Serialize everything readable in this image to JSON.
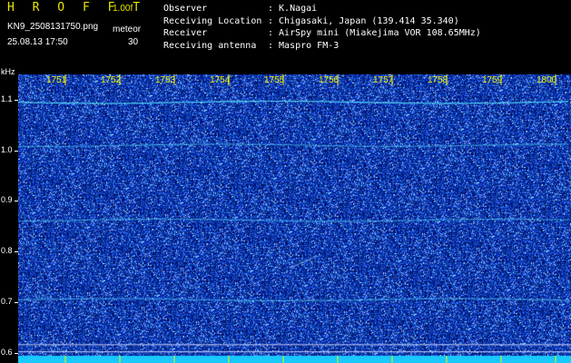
{
  "header": {
    "app_title": "H R O F F T",
    "version": "1.00f",
    "filename": "KN9_2508131750.png",
    "meteor_label": "meteor",
    "datetime": "25.08.13 17:50",
    "meteor_count": "30"
  },
  "info": [
    {
      "key": "Observer",
      "value": ": K.Nagai"
    },
    {
      "key": "Receiving Location",
      "value": ": Chigasaki, Japan (139.414 35.340)"
    },
    {
      "key": "Receiver",
      "value": ": AirSpy mini (Miakejima VOR 108.65MHz)"
    },
    {
      "key": "Receiving antenna",
      "value": ": Maspro FM-3"
    }
  ],
  "plot": {
    "unit_label": "kHz",
    "y_ticks": [
      "1.1",
      "1.0",
      "0.9",
      "0.8",
      "0.7",
      "0.6"
    ],
    "y_range": [
      0.58,
      1.15
    ],
    "x_ticks": [
      "1751",
      "1752",
      "1753",
      "1754",
      "1755",
      "1756",
      "1757",
      "1758",
      "1759",
      "1800"
    ],
    "colors": {
      "background": "#0a1ea0",
      "noise_dark": "#001070",
      "noise_light": "#3a78ff",
      "trace": "#55e0ff",
      "bottom_band": "#19c8ff",
      "tick_label_bg": "#f0f000"
    }
  }
}
